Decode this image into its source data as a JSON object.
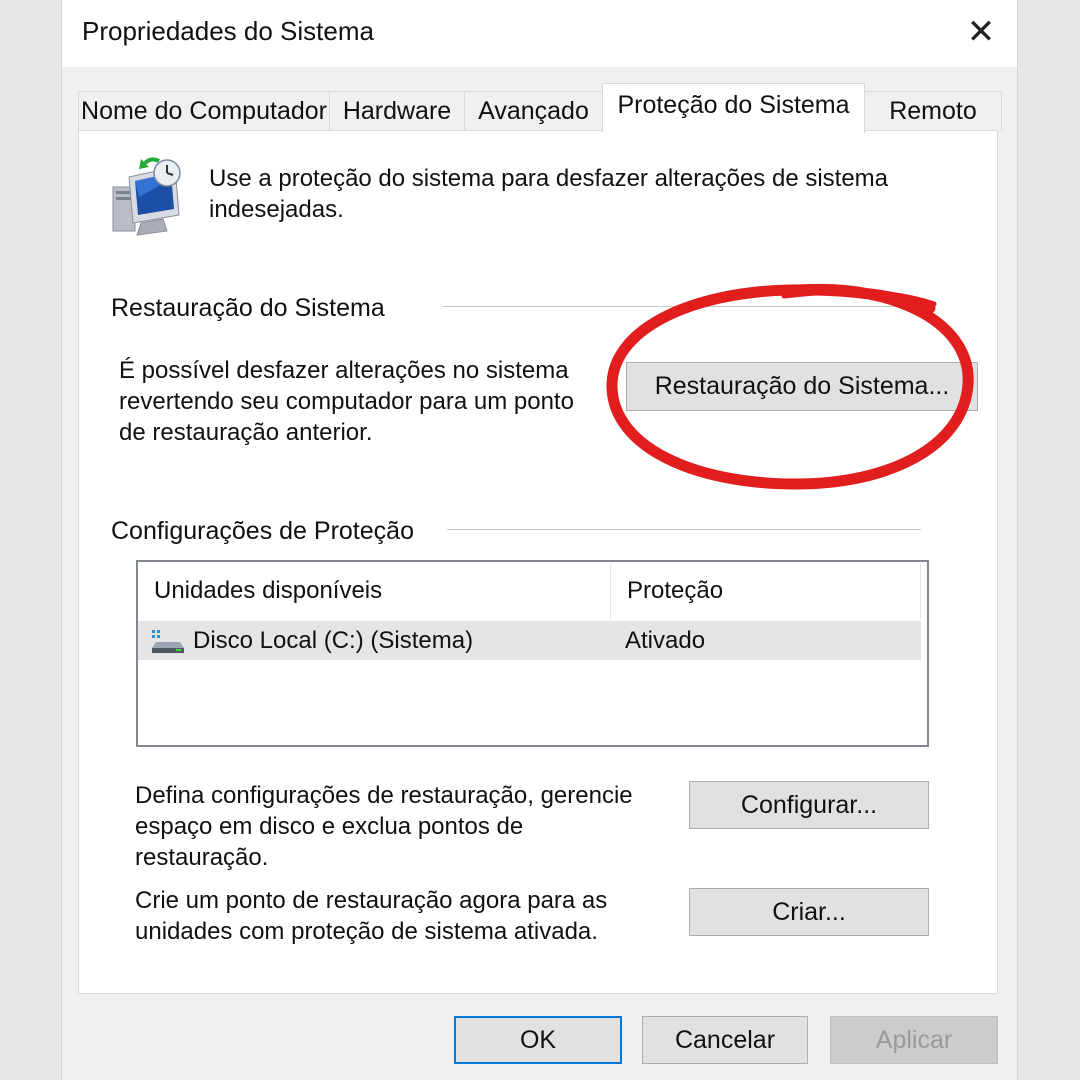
{
  "window": {
    "title": "Propriedades do Sistema",
    "close_glyph": "✕"
  },
  "tabs": [
    {
      "label": "Nome do Computador",
      "active": false
    },
    {
      "label": "Hardware",
      "active": false
    },
    {
      "label": "Avançado",
      "active": false
    },
    {
      "label": "Proteção do Sistema",
      "active": true
    },
    {
      "label": "Remoto",
      "active": false
    }
  ],
  "intro": {
    "icon": "system-protection-icon",
    "text_line1": "Use a proteção do sistema para desfazer alterações de sistema",
    "text_line2": "indesejadas."
  },
  "restore_group": {
    "label": "Restauração do Sistema",
    "desc_line1": "É possível desfazer alterações no sistema",
    "desc_line2": "revertendo seu computador para um ponto",
    "desc_line3": "de restauração anterior.",
    "button_label": "Restauração do Sistema..."
  },
  "protection_group": {
    "label": "Configurações de Proteção",
    "columns": [
      "Unidades disponíveis",
      "Proteção"
    ],
    "rows": [
      {
        "drive": "Disco Local (C:) (Sistema)",
        "protection": "Ativado",
        "icon": "drive-icon"
      }
    ],
    "configure_text_line1": "Defina configurações de restauração, gerencie",
    "configure_text_line2": "espaço em disco e exclua pontos de",
    "configure_text_line3": "restauração.",
    "configure_button": "Configurar...",
    "create_text_line1": "Crie um ponto de restauração agora para as",
    "create_text_line2": "unidades com proteção de sistema ativada.",
    "create_button": "Criar..."
  },
  "footer": {
    "ok": "OK",
    "cancel": "Cancelar",
    "apply": "Aplicar"
  },
  "colors": {
    "highlight_ellipse": "#e11d1d",
    "default_button_border": "#0078d7"
  }
}
